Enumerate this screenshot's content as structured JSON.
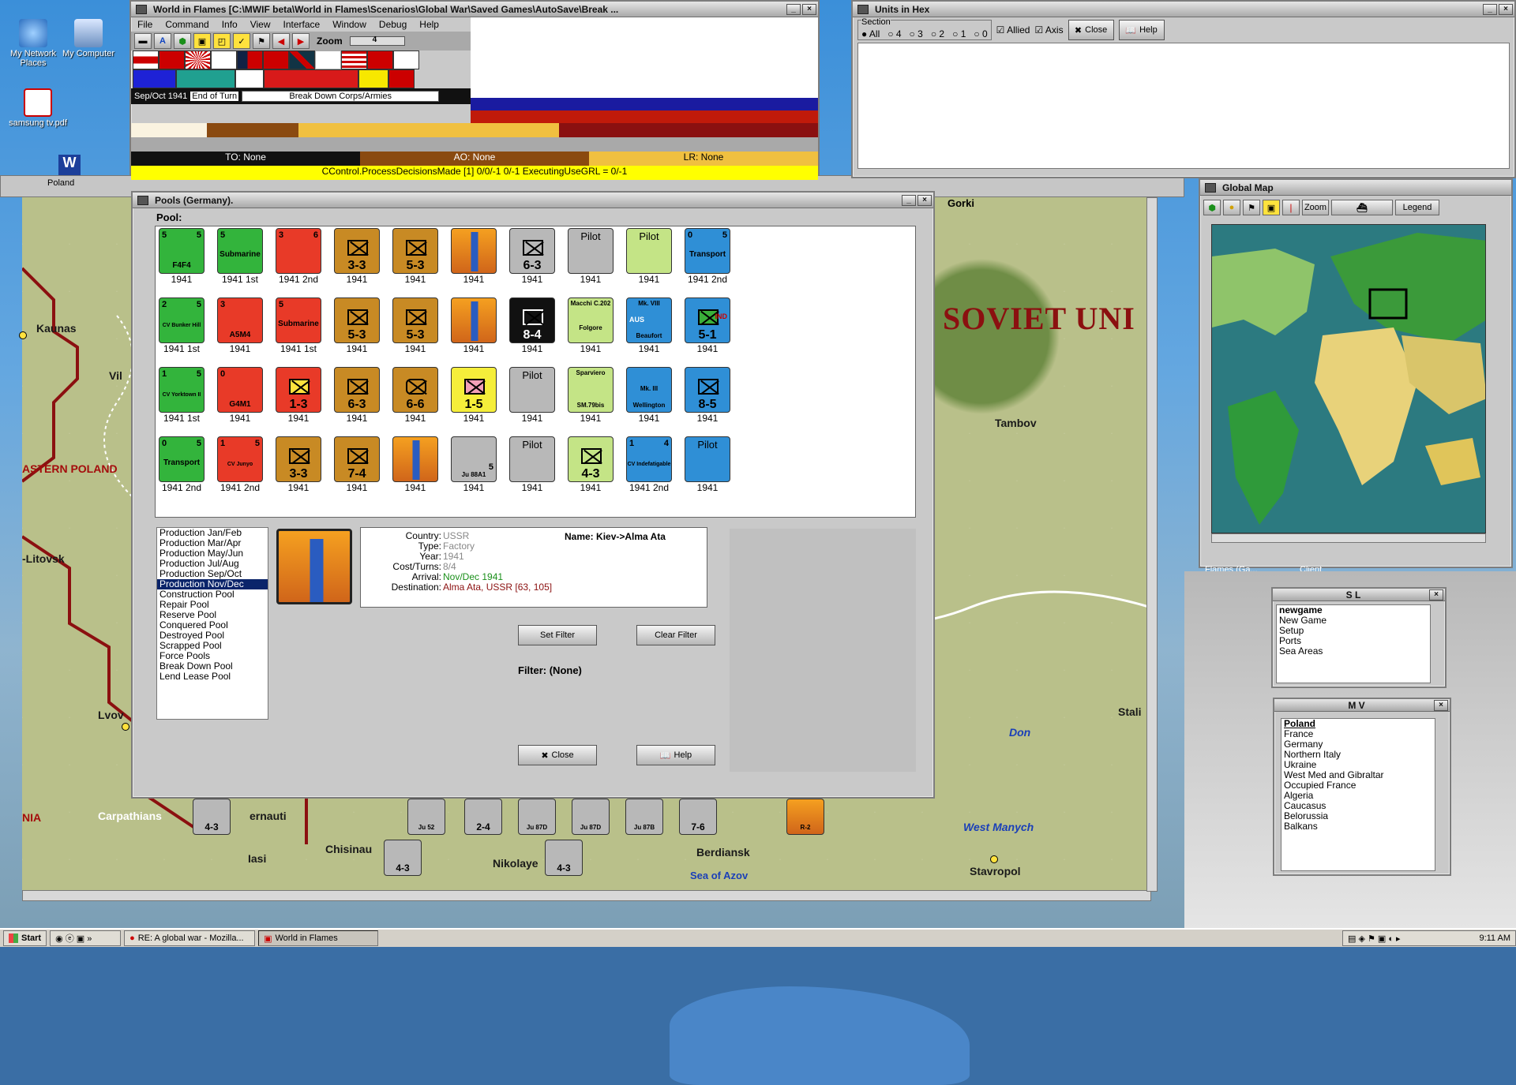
{
  "desktop": {
    "icons": [
      {
        "label": "My Network Places"
      },
      {
        "label": "My Computer"
      },
      {
        "label": "samsung tv.pdf"
      }
    ]
  },
  "main_window": {
    "title": "World in Flames [C:\\MWIF beta\\World in Flames\\Scenarios\\Global War\\Saved Games\\AutoSave\\Break ...",
    "menu": [
      "File",
      "Command",
      "Info",
      "View",
      "Interface",
      "Window",
      "Debug",
      "Help"
    ],
    "toolbar_zoom_label": "Zoom",
    "zoom_value": "4",
    "date": "Sep/Oct 1941",
    "end_of_turn": "End of Turn",
    "phase": "Break Down Corps/Armies",
    "to": "TO: None",
    "ao": "AO: None",
    "lr": "LR: None",
    "status": "CControl.ProcessDecisionsMade [1] 0/0/-1 0/-1 ExecutingUseGRL = 0/-1"
  },
  "units_in_hex": {
    "title": "Units in Hex",
    "section_label": "Section",
    "radio_options": [
      "All",
      "4",
      "3",
      "2",
      "1",
      "0"
    ],
    "allied_label": "Allied",
    "axis_label": "Axis",
    "close_label": "Close",
    "help_label": "Help"
  },
  "poland_tab": "Poland",
  "pools_window": {
    "title": "Pools (Germany).",
    "pool_label": "Pool:",
    "units": [
      [
        "1941",
        "1941 1st",
        "1941 2nd",
        "1941",
        "1941",
        "1941",
        "1941",
        "1941",
        "1941",
        "1941 2nd"
      ],
      [
        "1941 1st",
        "1941",
        "1941 1st",
        "1941",
        "1941",
        "1941",
        "1941",
        "1941",
        "1941",
        "1941"
      ],
      [
        "1941 1st",
        "1941",
        "1941",
        "1941",
        "1941",
        "1941",
        "1941",
        "1941",
        "1941",
        "1941"
      ],
      [
        "1941 2nd",
        "1941 2nd",
        "1941",
        "1941",
        "1941",
        "1941",
        "1941",
        "1941",
        "1941 2nd",
        "1941"
      ]
    ],
    "unit_texts": {
      "f4f4": "F4F4",
      "submarine": "Submarine",
      "transport": "Transport",
      "pilot": "Pilot",
      "cv_bunker_hill": "CV Bunker Hill",
      "a5m4": "A5M4",
      "macchi": "Macchi C.202",
      "folgore": "Folgore",
      "mk8": "Mk. VIII",
      "beaufort": "Beaufort",
      "aus": "AUS",
      "ind": "IND",
      "sparviero": "Sparviero",
      "sm79": "SM.79bis",
      "mk3": "Mk. III",
      "wellington": "Wellington",
      "cv_yorktown": "CV Yorktown II",
      "g4m1": "G4M1",
      "cv_junyo": "CV Junyo",
      "cv_indefatigable": "CV Indefatigable",
      "ju88": "Ju 88A1",
      "v_6_3": "6-3",
      "v_3_3": "3-3",
      "v_5_3": "5-3",
      "v_8_4": "8-4",
      "v_5_1": "5-1",
      "v_1_3": "1-3",
      "v_6_3b": "6-3",
      "v_6_6": "6-6",
      "v_1_5": "1-5",
      "v_8_5": "8-5",
      "v_3_3b": "3-3",
      "v_7_4": "7-4",
      "v_4_3": "4-3"
    },
    "list": [
      "Production Jan/Feb",
      "Production Mar/Apr",
      "Production May/Jun",
      "Production Jul/Aug",
      "Production Sep/Oct",
      "Production Nov/Dec",
      "Construction Pool",
      "Repair Pool",
      "Reserve Pool",
      "Conquered Pool",
      "Destroyed Pool",
      "Scrapped Pool",
      "Force Pools",
      "Break Down Pool",
      "Lend Lease Pool"
    ],
    "selected_index": 5,
    "details": {
      "country_label": "Country:",
      "country": "USSR",
      "type_label": "Type:",
      "type": "Factory",
      "year_label": "Year:",
      "year": "1941",
      "cost_label": "Cost/Turns:",
      "cost": "8/4",
      "arrival_label": "Arrival:",
      "arrival": "Nov/Dec 1941",
      "dest_label": "Destination:",
      "dest": "Alma Ata, USSR [63, 105]",
      "name_label": "Name:",
      "name": "Kiev->Alma Ata"
    },
    "set_filter": "Set Filter",
    "clear_filter": "Clear Filter",
    "filter": "Filter: (None)",
    "close": "Close",
    "help": "Help"
  },
  "global_map": {
    "title": "Global Map",
    "zoom": "Zoom",
    "legend": "Legend",
    "footer_left": "Flames (Ga...",
    "footer_right": "Client"
  },
  "sl_window": {
    "title": "S L",
    "items": [
      "newgame",
      "New Game",
      "Setup",
      "Ports",
      "Sea Areas"
    ]
  },
  "mv_window": {
    "title": "M V",
    "items": [
      "Poland",
      "France",
      "Germany",
      "Northern Italy",
      "Ukraine",
      "West Med and Gibraltar",
      "Occupied France",
      "Algeria",
      "Caucasus",
      "Belorussia",
      "Balkans"
    ]
  },
  "map_labels": {
    "kaunas": "Kaunas",
    "vil": "Vil",
    "eastern_poland": "ASTERN POLAND",
    "litovsk": "-Litovsk",
    "lvov": "Lvov",
    "carpathians": "Carpathians",
    "cernauti": "ernauti",
    "iasi": "Iasi",
    "chisinau": "Chisinau",
    "nikolaye": "Nikolaye",
    "berdiansk": "Berdiansk",
    "sea_of_azov": "Sea of Azov",
    "stavropol": "Stavropol",
    "west_manych": "West Manych",
    "don": "Don",
    "stali": "Stali",
    "tambov": "Tambov",
    "gorki": "Gorki",
    "soviet_union": "SOVIET UNI",
    "nia": "NIA",
    "map_units": [
      {
        "label": "4-3"
      },
      {
        "label": "Ju 52"
      },
      {
        "label": "2-4"
      },
      {
        "label": "Ju 87D"
      },
      {
        "label": "Ju 87D"
      },
      {
        "label": "Ju 87B"
      },
      {
        "label": "7-6"
      },
      {
        "label": "R-2"
      },
      {
        "label": "4-3"
      },
      {
        "label": "4-3"
      }
    ]
  },
  "taskbar": {
    "start": "Start",
    "tasks": [
      "RE: A global war - Mozilla...",
      "World in Flames"
    ],
    "clock": "9:11 AM"
  }
}
